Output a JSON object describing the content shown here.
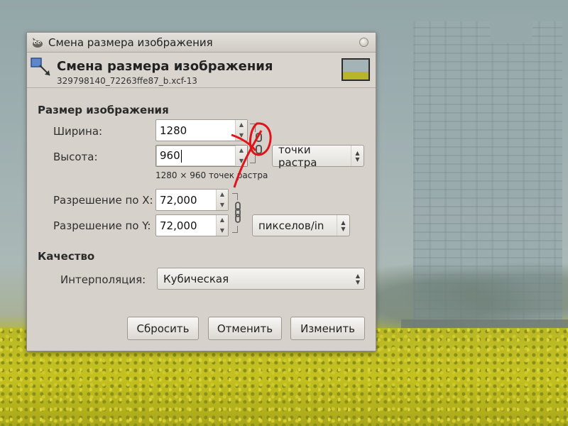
{
  "window": {
    "title": "Смена размера изображения",
    "icon": "gimp-wilber-icon"
  },
  "header": {
    "title": "Смена размера изображения",
    "subtitle": "329798140_72263ffe87_b.xcf-13",
    "icon": "resize-image-icon",
    "thumbnail": "image-thumbnail"
  },
  "image_size": {
    "section_title": "Размер изображения",
    "width_label": "Ширина:",
    "width_value": "1280",
    "height_label": "Высота:",
    "height_value": "960",
    "units": "точки растра",
    "summary": "1280 × 960 точек растра",
    "chain_state": "broken"
  },
  "resolution": {
    "x_label": "Разрешение по X:",
    "x_value": "72,000",
    "y_label": "Разрешение по Y:",
    "y_value": "72,000",
    "units": "пикселов/in",
    "chain_state": "linked"
  },
  "quality": {
    "section_title": "Качество",
    "interpolation_label": "Интерполяция:",
    "interpolation_value": "Кубическая"
  },
  "buttons": {
    "reset": "Сбросить",
    "cancel": "Отменить",
    "apply": "Изменить"
  },
  "colors": {
    "dialog_bg": "#d6d2cb",
    "annotation_red": "#e0141a"
  }
}
